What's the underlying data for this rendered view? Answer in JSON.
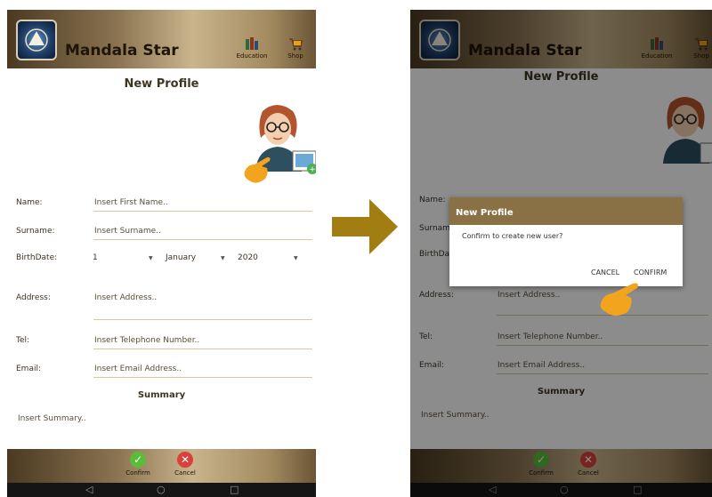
{
  "app": {
    "title": "Mandala Star",
    "nav": [
      {
        "label": "Education",
        "icon": "books-icon"
      },
      {
        "label": "Shop",
        "icon": "cart-icon"
      }
    ]
  },
  "page": {
    "title": "New Profile"
  },
  "form": {
    "name": {
      "label": "Name:",
      "placeholder": "Insert First Name.."
    },
    "surname": {
      "label": "Surname:",
      "placeholder": "Insert Surname.."
    },
    "birthdate": {
      "label": "BirthDate:",
      "day": "1",
      "month": "January",
      "year": "2020"
    },
    "address": {
      "label": "Address:",
      "placeholder": "Insert Address.."
    },
    "tel": {
      "label": "Tel:",
      "placeholder": "Insert Telephone Number.."
    },
    "email": {
      "label": "Email:",
      "placeholder": "Insert Email Address.."
    },
    "summary": {
      "title": "Summary",
      "placeholder": "Insert Summary.."
    }
  },
  "bottom": {
    "confirm_label": "Confirm",
    "cancel_label": "Cancel"
  },
  "dialog": {
    "title": "New Profile",
    "message": "Confirm to create new user?",
    "cancel": "CANCEL",
    "confirm": "CONFIRM"
  },
  "sysnav": {
    "back": "◁",
    "home": "○",
    "recent": "□"
  },
  "colors": {
    "brand_dark": "#4a3a22",
    "brand_light": "#c9b48c",
    "dialog_header": "#8a7045",
    "confirm_green": "#5dbb3a",
    "cancel_red": "#d9413a",
    "arrow": "#a27d12"
  }
}
